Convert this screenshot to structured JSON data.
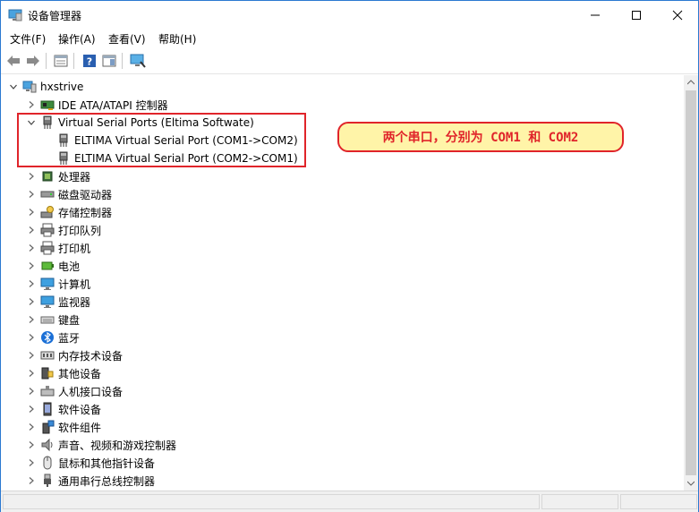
{
  "window": {
    "title": "设备管理器"
  },
  "menu": [
    "文件(F)",
    "操作(A)",
    "查看(V)",
    "帮助(H)"
  ],
  "tree": {
    "root": "hxstrive",
    "ide": "IDE ATA/ATAPI 控制器",
    "vsp": "Virtual Serial Ports (Eltima Softwate)",
    "vsp_children": [
      "ELTIMA Virtual Serial Port (COM1->COM2)",
      "ELTIMA Virtual Serial Port (COM2->COM1)"
    ],
    "categories": [
      "处理器",
      "磁盘驱动器",
      "存储控制器",
      "打印队列",
      "打印机",
      "电池",
      "计算机",
      "监视器",
      "键盘",
      "蓝牙",
      "内存技术设备",
      "其他设备",
      "人机接口设备",
      "软件设备",
      "软件组件",
      "声音、视频和游戏控制器",
      "鼠标和其他指针设备",
      "通用串行总线控制器"
    ]
  },
  "annotation": {
    "text": "两个串口，分别为 COM1 和 COM2"
  },
  "colors": {
    "accent": "#2b79d1",
    "highlight": "#e0242a",
    "callout_bg": "#fff4a8"
  }
}
